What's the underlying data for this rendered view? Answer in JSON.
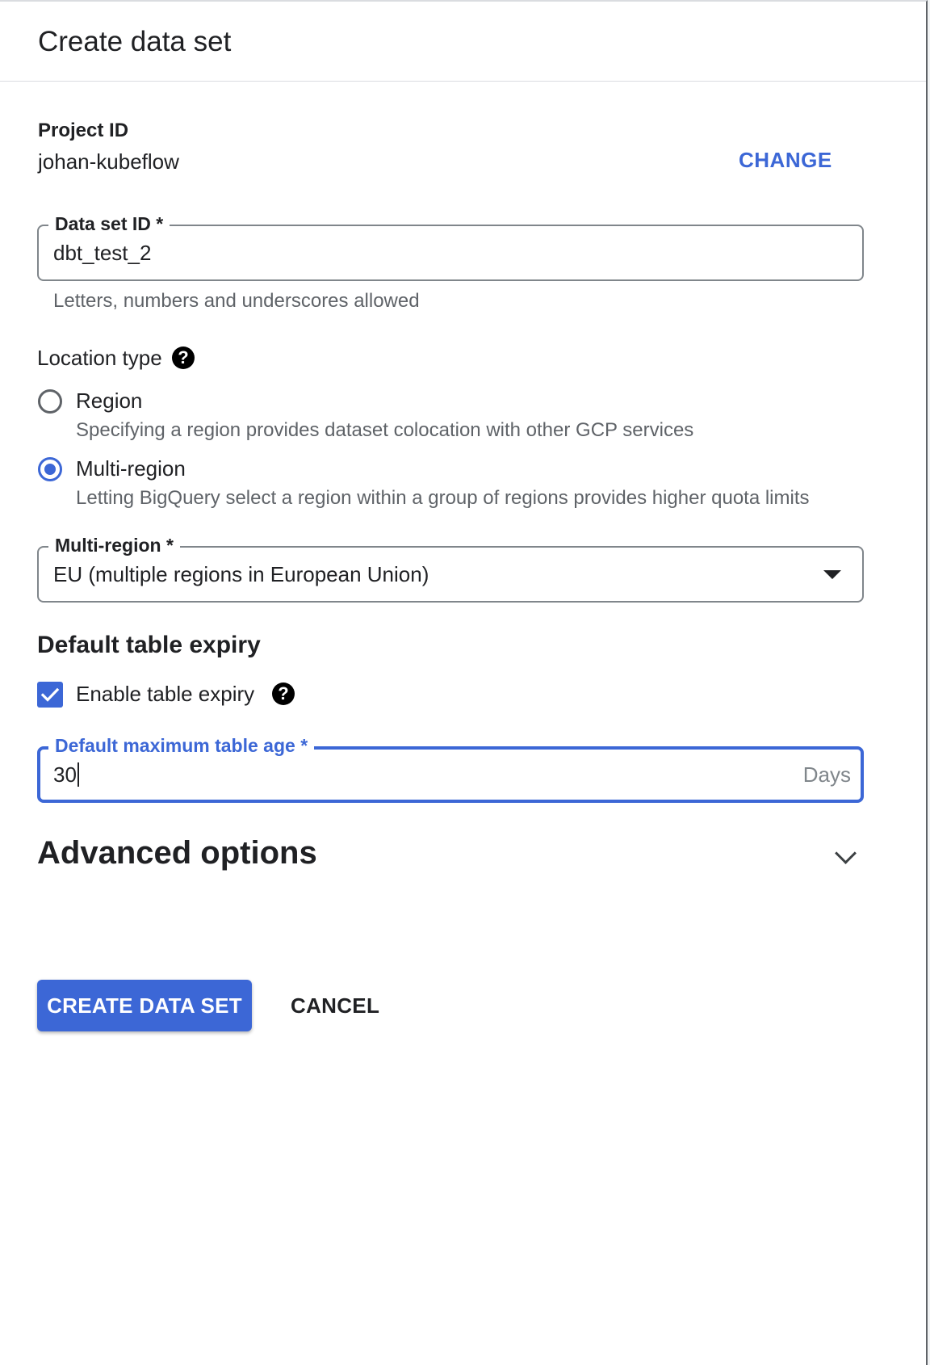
{
  "dialog": {
    "title": "Create data set"
  },
  "project": {
    "label": "Project ID",
    "value": "johan-kubeflow",
    "change_label": "CHANGE"
  },
  "dataset_id": {
    "label": "Data set ID *",
    "value": "dbt_test_2",
    "hint": "Letters, numbers and underscores allowed"
  },
  "location": {
    "heading": "Location type",
    "help_icon": "help-icon",
    "options": [
      {
        "label": "Region",
        "description": "Specifying a region provides dataset colocation with other GCP services",
        "selected": false
      },
      {
        "label": "Multi-region",
        "description": "Letting BigQuery select a region within a group of regions provides higher quota limits",
        "selected": true
      }
    ]
  },
  "multi_region": {
    "label": "Multi-region *",
    "selected_value": "EU (multiple regions in European Union)"
  },
  "expiry": {
    "heading": "Default table expiry",
    "checkbox_label": "Enable table expiry",
    "checked": true,
    "age_label": "Default maximum table age *",
    "age_value": "30",
    "age_suffix": "Days"
  },
  "advanced": {
    "heading": "Advanced options",
    "expanded": false
  },
  "actions": {
    "create_label": "CREATE DATA SET",
    "cancel_label": "CANCEL"
  },
  "colors": {
    "accent": "#3c67d6",
    "text": "#202124",
    "muted": "#5f6368",
    "border": "#80868b"
  }
}
